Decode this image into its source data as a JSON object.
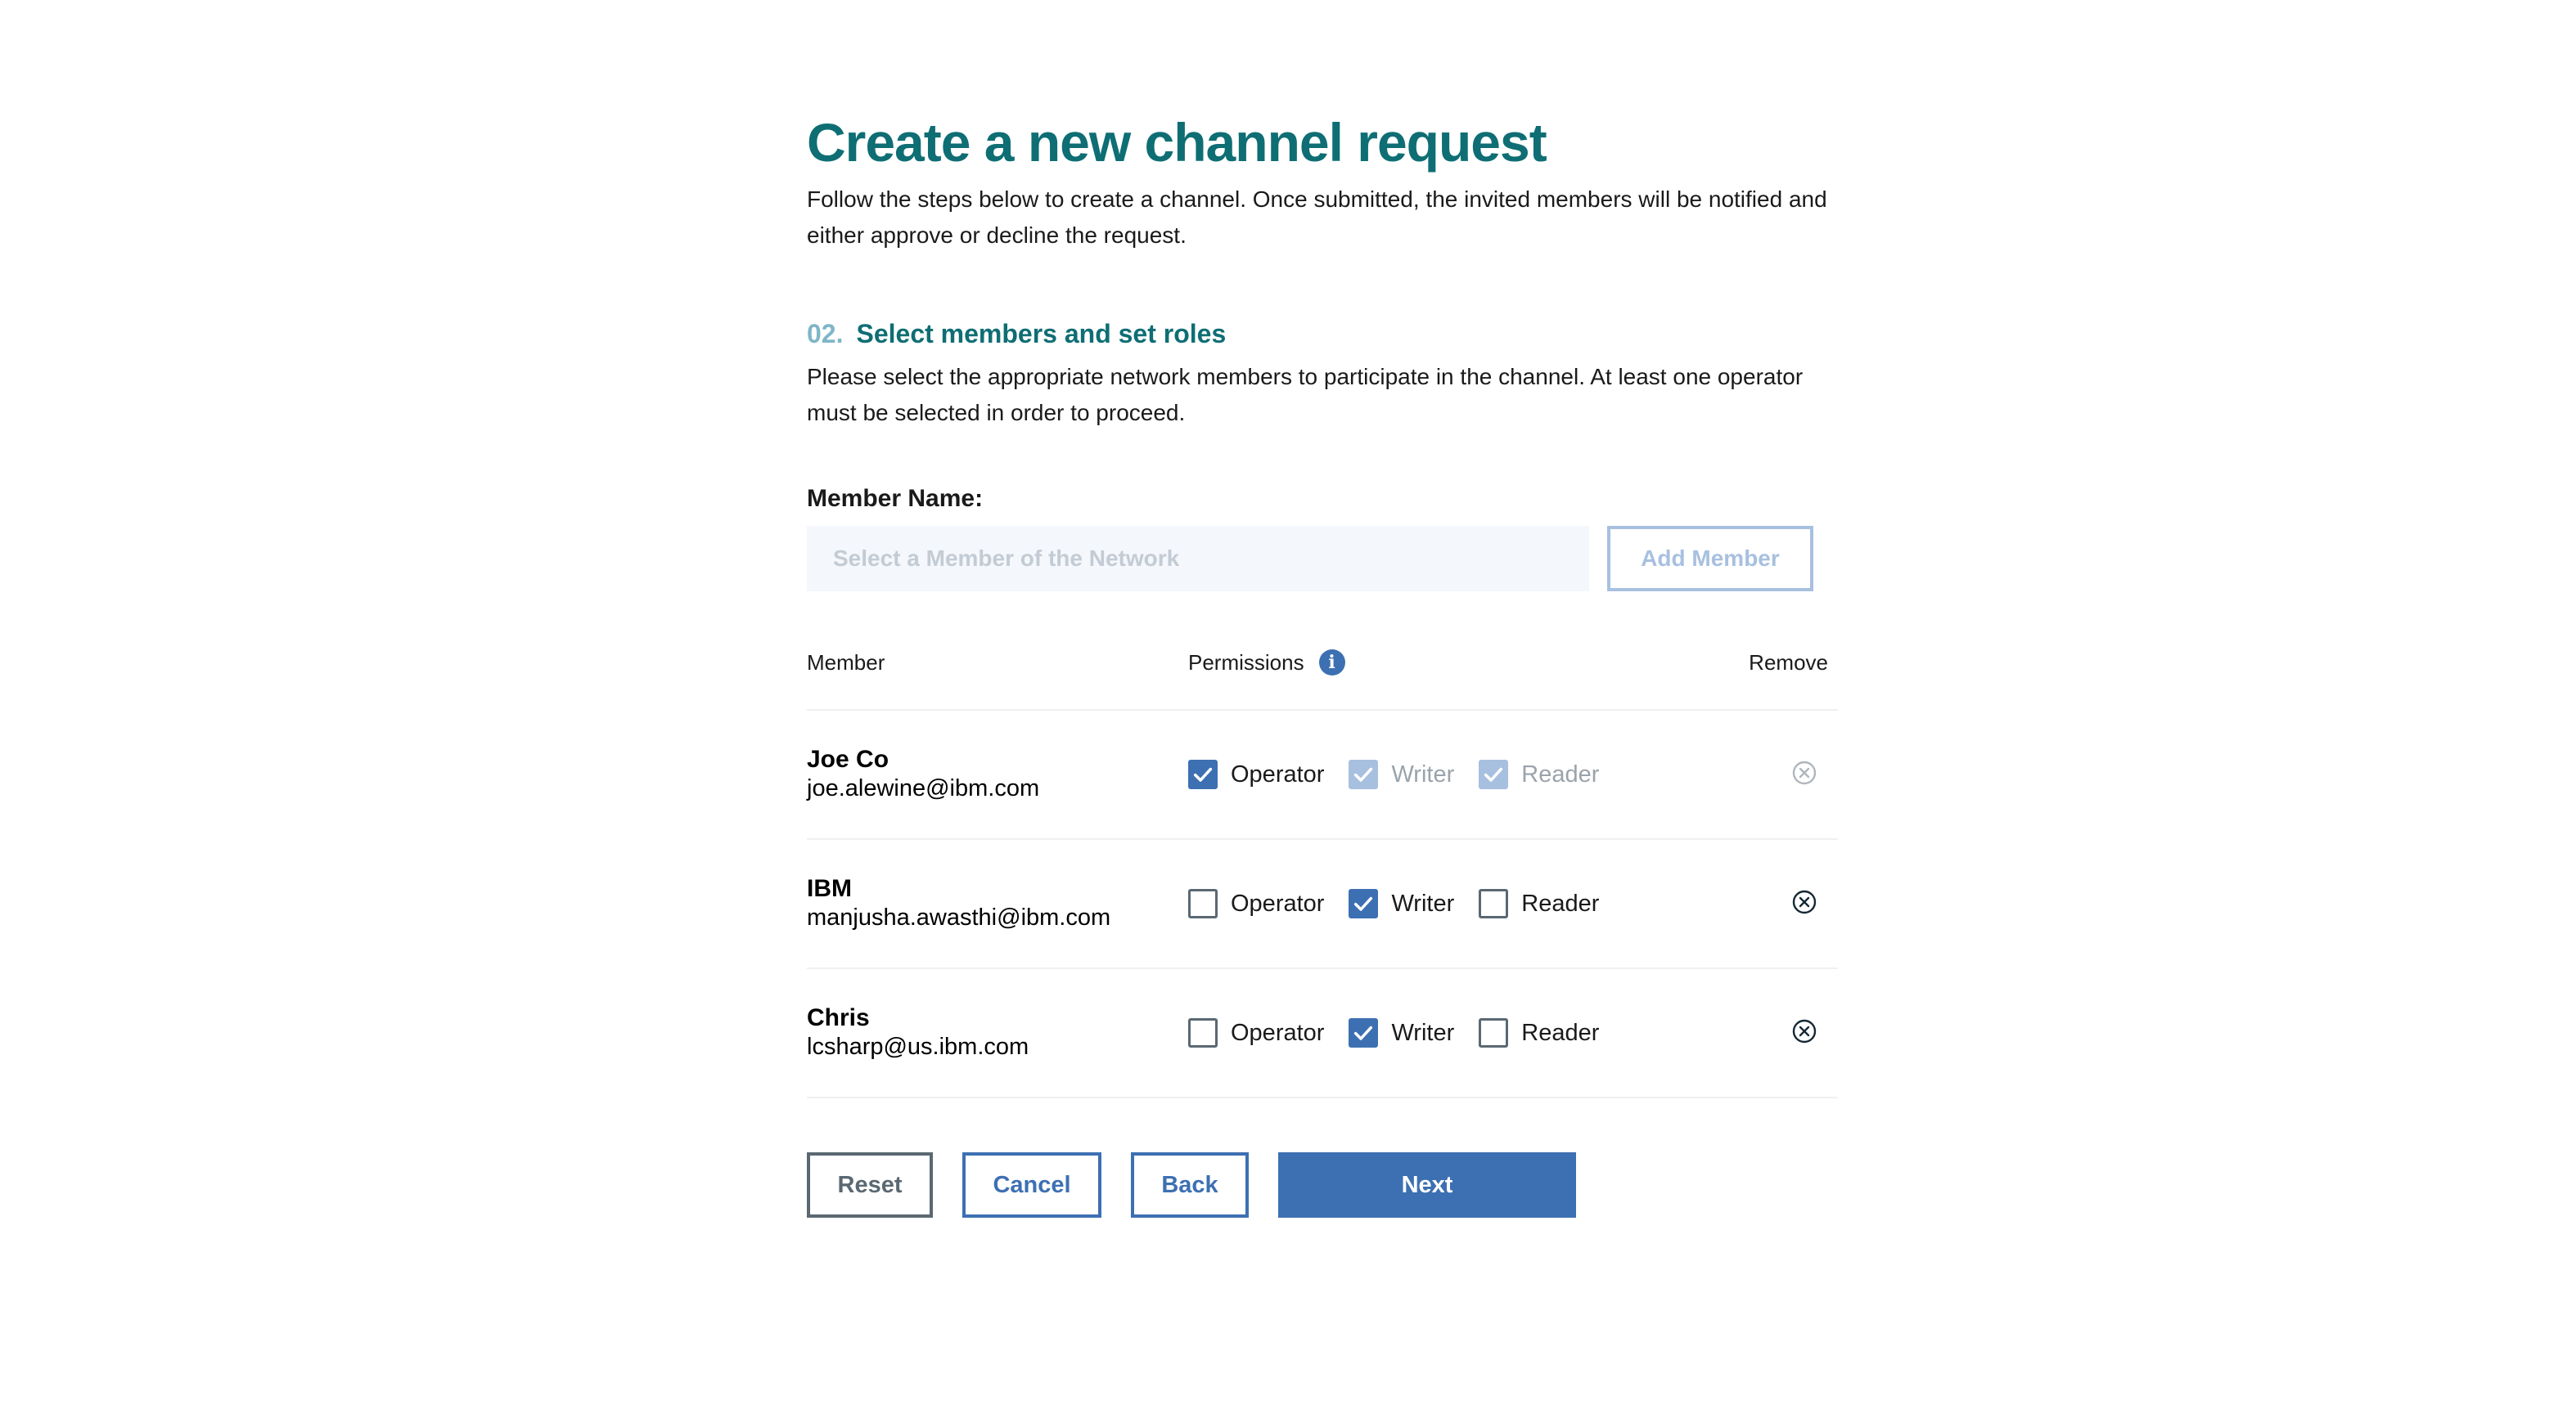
{
  "page": {
    "title": "Create a new channel request",
    "intro": "Follow the steps below to create a channel. Once submitted, the invited members will be notified and either approve or decline the request."
  },
  "step": {
    "number": "02.",
    "title": "Select members and set roles",
    "description": "Please select the appropriate network members to participate in the channel. At least one operator must be selected in order to proceed."
  },
  "member_field": {
    "label": "Member Name:",
    "placeholder": "Select a Member of the Network",
    "value": "",
    "add_button": "Add Member"
  },
  "table": {
    "headers": {
      "member": "Member",
      "permissions": "Permissions",
      "remove": "Remove"
    },
    "info_icon": "info-icon",
    "rows": [
      {
        "name": "Joe Co",
        "email": "joe.alewine@ibm.com",
        "operator_label": "Operator",
        "writer_label": "Writer",
        "reader_label": "Reader",
        "operator": true,
        "writer": true,
        "reader": true,
        "writer_disabled": true,
        "reader_disabled": true,
        "remove_disabled": true
      },
      {
        "name": "IBM",
        "email": "manjusha.awasthi@ibm.com",
        "operator_label": "Operator",
        "writer_label": "Writer",
        "reader_label": "Reader",
        "operator": false,
        "writer": true,
        "reader": false,
        "writer_disabled": false,
        "reader_disabled": false,
        "remove_disabled": false
      },
      {
        "name": "Chris",
        "email": "lcsharp@us.ibm.com",
        "operator_label": "Operator",
        "writer_label": "Writer",
        "reader_label": "Reader",
        "operator": false,
        "writer": true,
        "reader": false,
        "writer_disabled": false,
        "reader_disabled": false,
        "remove_disabled": false
      }
    ]
  },
  "actions": {
    "reset": "Reset",
    "cancel": "Cancel",
    "back": "Back",
    "next": "Next"
  },
  "colors": {
    "title": "#0e6e74",
    "step_number": "#7fb6c7",
    "primary": "#3d70b2",
    "disabled_check": "#a8c0e0"
  }
}
